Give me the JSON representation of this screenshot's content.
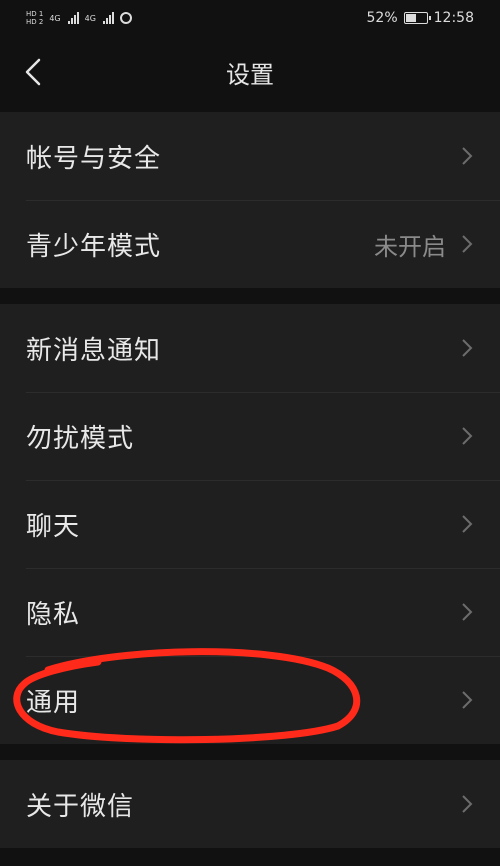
{
  "status_bar": {
    "hd1": "HD 1",
    "hd2": "HD 2",
    "net1": "4G",
    "net2": "4G",
    "battery_percent": 52,
    "battery_text": "52%",
    "time": "12:58",
    "icons": [
      "signal-icon",
      "alarm-icon",
      "battery-icon"
    ]
  },
  "nav": {
    "title": "设置",
    "back_icon": "chevron-left-icon"
  },
  "groups": [
    {
      "items": [
        {
          "label": "帐号与安全",
          "value": ""
        },
        {
          "label": "青少年模式",
          "value": "未开启"
        }
      ]
    },
    {
      "items": [
        {
          "label": "新消息通知",
          "value": ""
        },
        {
          "label": "勿扰模式",
          "value": ""
        },
        {
          "label": "聊天",
          "value": ""
        },
        {
          "label": "隐私",
          "value": ""
        },
        {
          "label": "通用",
          "value": ""
        }
      ]
    },
    {
      "items": [
        {
          "label": "关于微信",
          "value": ""
        }
      ]
    }
  ],
  "colors": {
    "background": "#111111",
    "cell": "#1f1f1f",
    "text": "#e8e8e8",
    "secondary": "#8a8a8a",
    "annotation": "#ff2a1a"
  }
}
